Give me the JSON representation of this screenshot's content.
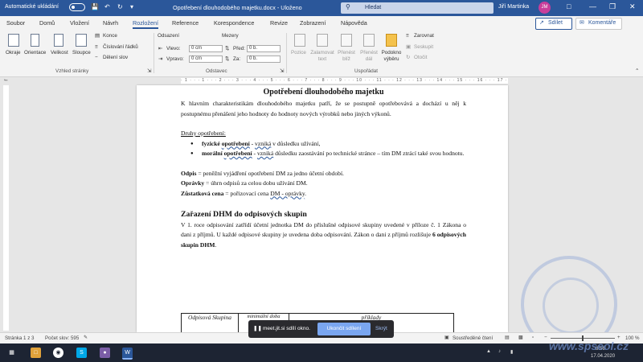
{
  "titlebar": {
    "autosave_label": "Automatické ukládání",
    "autosave_state": "off",
    "document_title": "Opotřebení dlouhodobého majetku.docx - Uloženo",
    "search_label": "Hledat",
    "user_name": "Jiří Martinka",
    "user_initials": "JM"
  },
  "tabs": [
    "Soubor",
    "Domů",
    "Vložení",
    "Návrh",
    "Rozložení",
    "Reference",
    "Korespondence",
    "Revize",
    "Zobrazení",
    "Nápověda"
  ],
  "active_tab": "Rozložení",
  "share_label": "Sdílet",
  "comments_label": "Komentáře",
  "ribbon": {
    "page_setup": {
      "margins": "Okraje",
      "orientation": "Orientace",
      "size": "Velikost",
      "columns": "Sloupce",
      "breaks": "Konce",
      "line_numbers": "Číslování řádků",
      "hyphenation": "Dělení slov",
      "group_label": "Vzhled stránky"
    },
    "paragraph": {
      "indent_label": "Odsazení",
      "spacing_label": "Mezery",
      "left_label": "Vlevo:",
      "right_label": "Vpravo:",
      "before_label": "Před:",
      "after_label": "Za:",
      "left_value": "0 cm",
      "right_value": "0 cm",
      "before_value": "0 b.",
      "after_value": "0 b.",
      "group_label": "Odstavec"
    },
    "arrange": {
      "position": "Pozice",
      "wrap_text": "Zalamovat text",
      "bring_forward": "Přenést blíž",
      "send_backward": "Přenést dál",
      "selection_pane": "Podokno výběru",
      "align": "Zarovnat",
      "group": "Seskupit",
      "rotate": "Otočit",
      "group_label": "Uspořádat"
    }
  },
  "ruler_text": "· 1 · · · 1 · · · 2 · · · 3 · · · 4 · · · 5 · · · 6 · · · 7 · · · 8 · · · 9 · · · 10 · · · 11 · · · 12 · · · 13 · · · 14 · · · 15 · · · 16 · · · 17 · · · 18",
  "document": {
    "title": "Opotřebení dlouhodobého majetku",
    "intro": "K hlavním charakteristikám dlouhodobého majetku patří, že se postupně opotřebovává a dochází u něj k postupnému přenášení jeho hodnoty do hodnoty nových výrobků nebo jiných výkonů.",
    "types_heading": "Druhy opotřebení:",
    "bullet1": {
      "bold": "fyzické",
      "bold_wav": "opotřebení",
      "dash": " - ",
      "wav": "vzniká",
      "rest": " v důsledku užívání,"
    },
    "bullet2": {
      "bold": "morální",
      "bold_wav": "opotřebení",
      "dash": " - ",
      "wav": "vzniká",
      "rest": " důsledku zaostávání po technické stránce – tím DM ztrácí také svou hodnotu."
    },
    "def1": {
      "term": "Odpis",
      "text": " = peněžní vyjádření opotřebení DM za jedno účetní období."
    },
    "def2": {
      "term": "Oprávky",
      "text": " = úhrn odpisů za celou dobu užívání DM."
    },
    "def3": {
      "term": "Zůstatková cena",
      "text": " = pořizovací cena ",
      "wav": "DM - oprávky",
      "end": "."
    },
    "section_heading": "Zařazení DHM do odpisových skupin",
    "section_text": "V 1. roce odpisování zatřídí účetní jednotka DM do příslušné odpisové skupiny uvedené v příloze č. 1 Zákona o dani z příjmů. U každé odpisové skupiny je uvedena doba odpisování. Zákon o dani z příjmů rozlišuje ",
    "section_bold": "6 odpisových skupin DHM",
    "section_end": ".",
    "table": {
      "col1": "Odpisová Skupina",
      "col2": "minimální doba",
      "col3": "příklady"
    }
  },
  "status": {
    "page": "Stránka 1 z 3",
    "words": "Počet slov: 595",
    "focus": "Soustředěné čtení",
    "zoom": "100 %"
  },
  "share_notice": {
    "text": "meet.jit.si sdílí okno.",
    "stop": "Ukončit sdílení",
    "hide": "Skrýt"
  },
  "watermark": "www.spseol.cz",
  "clock": {
    "time": "8:56",
    "date": "17.04.2020"
  },
  "accent_color": "#2b579a"
}
